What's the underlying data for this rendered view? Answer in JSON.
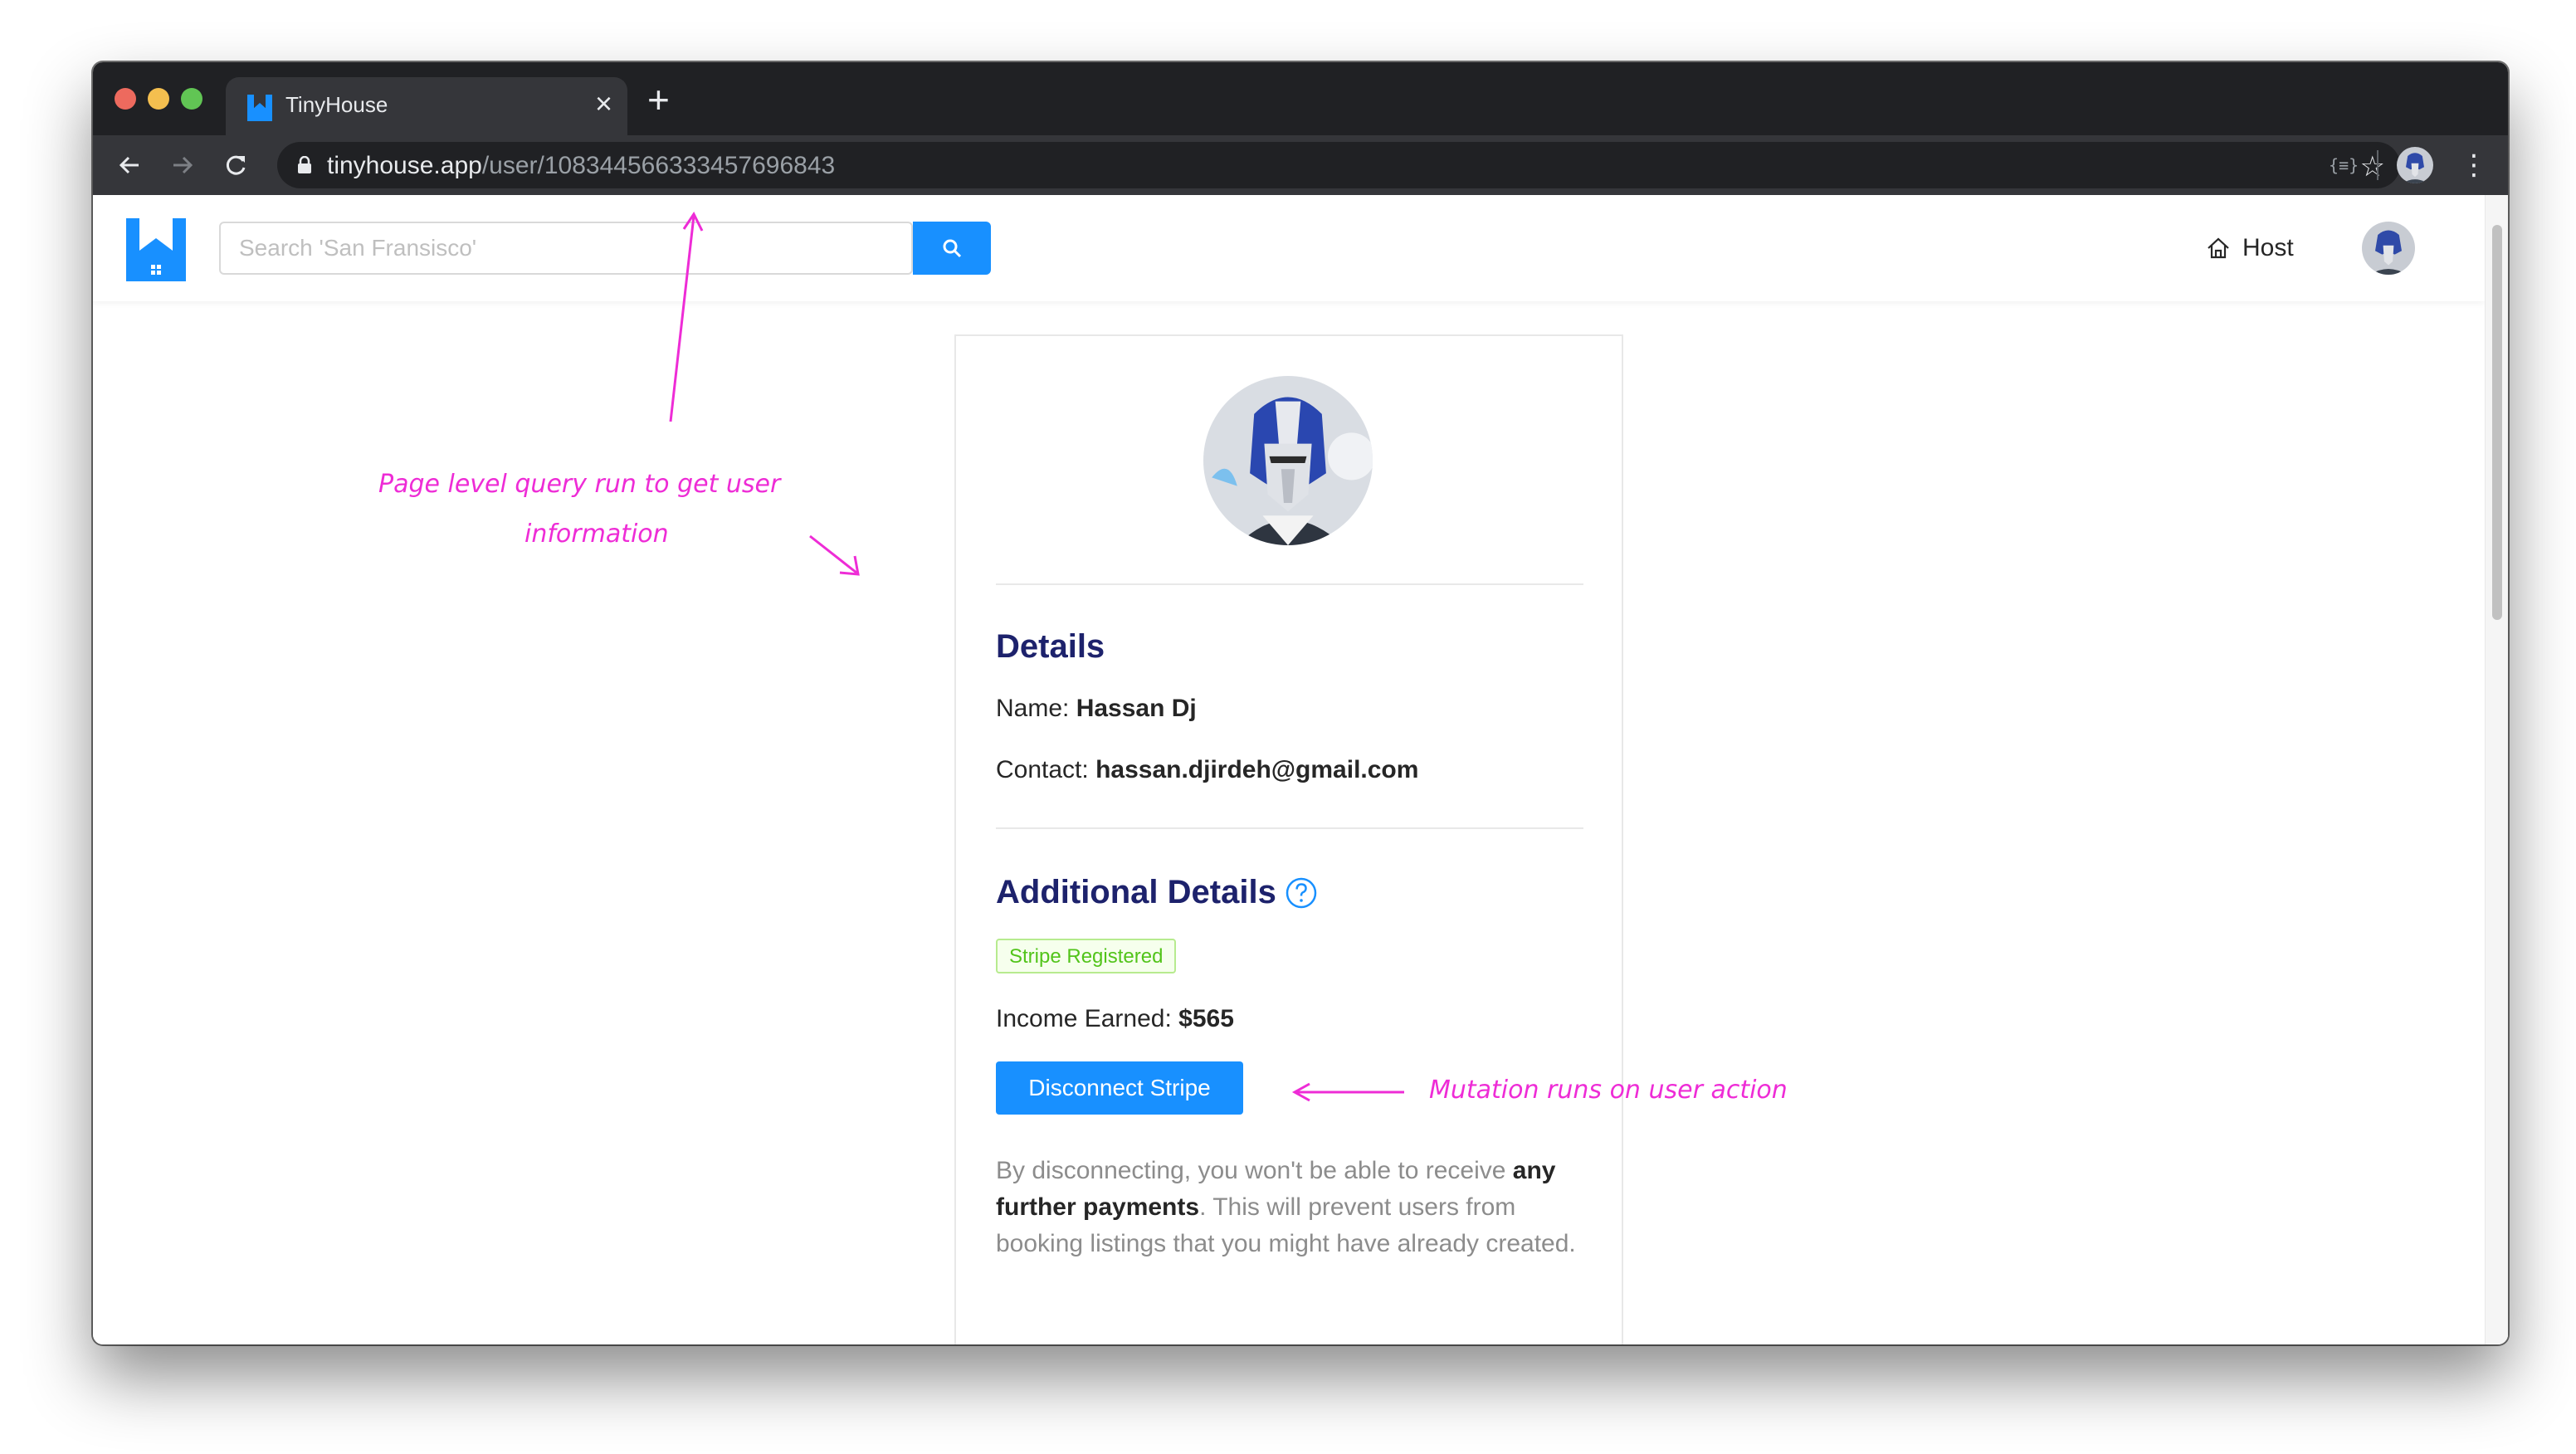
{
  "browser": {
    "tab_title": "TinyHouse",
    "url_host": "tinyhouse.app",
    "url_path": "/user/108344566333457696843",
    "ext_label": "{≡}"
  },
  "header": {
    "search_placeholder": "Search 'San Fransisco'",
    "host_label": "Host"
  },
  "user_card": {
    "details_title": "Details",
    "name_label": "Name:",
    "name_value": "Hassan Dj",
    "contact_label": "Contact:",
    "contact_value": "hassan.djirdeh@gmail.com",
    "additional_title": "Additional Details",
    "stripe_tag": "Stripe Registered",
    "income_label": "Income Earned:",
    "income_value": "$565",
    "disconnect_button": "Disconnect Stripe",
    "disconnect_text_1": "By disconnecting, you won't be able to receive ",
    "disconnect_text_bold": "any further payments",
    "disconnect_text_2": ". This will prevent users from booking listings that you might have already created."
  },
  "annotations": {
    "query_note_line1": "Page level query run to get user",
    "query_note_line2": "information",
    "mutation_note": "Mutation runs on user action"
  },
  "colors": {
    "accent": "#1890ff",
    "heading": "#1d226c",
    "annotation": "#ee2cd6",
    "success": "#52c41a"
  }
}
